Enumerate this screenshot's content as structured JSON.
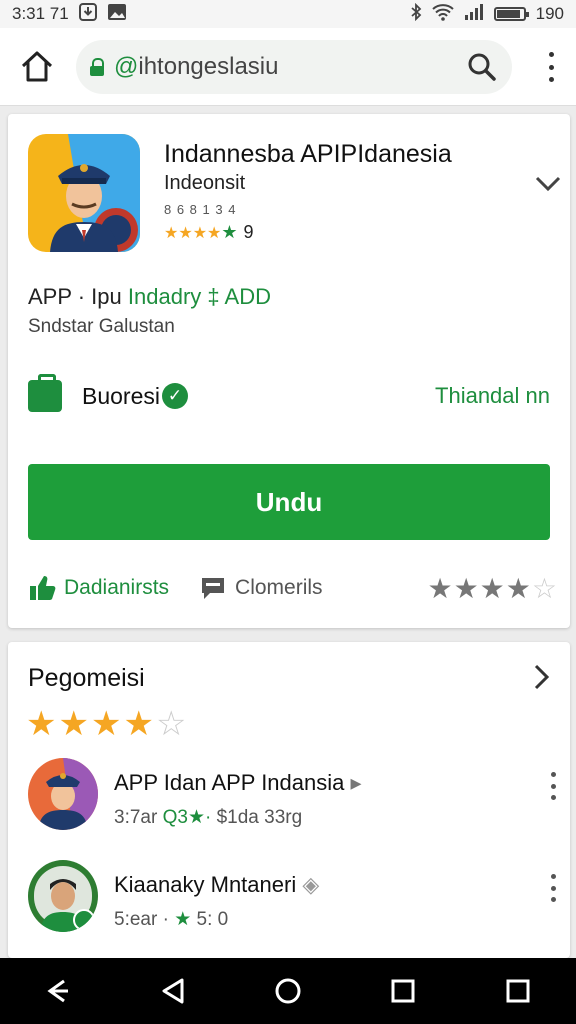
{
  "status_bar": {
    "time": "3:31 71",
    "battery_text": "190",
    "battery_level": 0.85,
    "icons": [
      "download-icon",
      "image-icon",
      "bluetooth-icon",
      "wifi-icon",
      "signal-icon",
      "battery-icon"
    ]
  },
  "browser": {
    "url_prefix": "@",
    "url_text": "ihtongeslasiu",
    "icons": [
      "home-icon",
      "lock-icon",
      "search-icon",
      "more-vert-icon"
    ]
  },
  "app": {
    "title": "Indannesba APIPIdanesia",
    "developer": "Indeonsit",
    "meta": "8 6 8 1 3 4",
    "rating_value": "9",
    "stars": 4,
    "category_prefix": "APP · Ipu",
    "category_green": "Indadry ‡ ADD",
    "subtitle": "Sndstar Galustan",
    "business_label": "Buoresi",
    "business_right": "Thiandal nn",
    "install_label": "Undu",
    "action_like": "Dadianirsts",
    "action_comment": "Clomerils",
    "action_stars": 3.5,
    "accent_color": "#1e9e3a",
    "star_color": "#f5a623"
  },
  "reviews": {
    "title": "Pegomeisi",
    "stars": 3.5,
    "items": [
      {
        "title": "APP Idan APP Indansia",
        "sub_prefix": "3:7ar",
        "sub_green": "Q3★·",
        "sub_suffix": "$1da 33rg"
      },
      {
        "title": "Kiaanaky Mntaneri",
        "sub_prefix": "5:ear ·",
        "sub_green": "★",
        "sub_suffix": "5: 0"
      }
    ]
  },
  "navbar": {
    "icons": [
      "back-icon",
      "back-triangle-icon",
      "home-circle-icon",
      "recents-icon",
      "square-icon"
    ]
  }
}
